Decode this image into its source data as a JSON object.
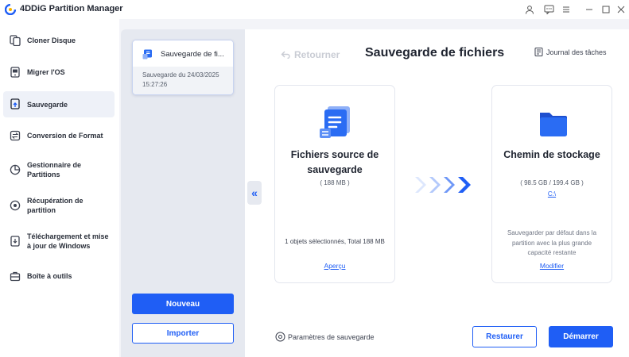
{
  "app": {
    "title": "4DDiG Partition Manager"
  },
  "titlebar": {
    "icons": [
      "user-icon",
      "feedback-icon",
      "settings-icon",
      "minimize-icon",
      "maximize-icon",
      "close-icon"
    ]
  },
  "sidebar": {
    "items": [
      {
        "label": "Cloner Disque",
        "icon": "clone-disk-icon",
        "active": false
      },
      {
        "label": "Migrer l'OS",
        "icon": "migrate-os-icon",
        "active": false
      },
      {
        "label": "Sauvegarde",
        "icon": "backup-icon",
        "active": true
      },
      {
        "label": "Conversion de Format",
        "icon": "convert-icon",
        "active": false
      },
      {
        "label": "Gestionnaire de Partitions",
        "icon": "partition-icon",
        "active": false
      },
      {
        "label": "Récupération de partition",
        "icon": "recovery-icon",
        "active": false
      },
      {
        "label": "Téléchargement et mise à jour de Windows",
        "icon": "windows-update-icon",
        "active": false
      },
      {
        "label": "Boîte à outils",
        "icon": "toolbox-icon",
        "active": false
      }
    ]
  },
  "tasks": {
    "card": {
      "title": "Sauvegarde de fi...",
      "meta": "Sauvegarde du 24/03/2025 15:27:26"
    },
    "new_label": "Nouveau",
    "import_label": "Importer"
  },
  "main": {
    "back_label": "Retourner",
    "title": "Sauvegarde de fichiers",
    "journal_label": "Journal des tâches",
    "source": {
      "title": "Fichiers source de sauvegarde",
      "size": "( 188 MB )",
      "summary": "1 objets sélectionnés, Total 188 MB",
      "link": "Aperçu"
    },
    "destination": {
      "title": "Chemin de stockage",
      "size": "( 98.5 GB / 199.4 GB )",
      "drive": "C:\\",
      "description": "Sauvegarder par défaut dans la partition avec la plus grande capacité restante",
      "link": "Modifier"
    },
    "params_label": "Paramètres de sauvegarde",
    "restore_label": "Restaurer",
    "start_label": "Démarrer"
  },
  "colors": {
    "accent": "#1f5ef5",
    "folder": "#2a6cf3"
  }
}
